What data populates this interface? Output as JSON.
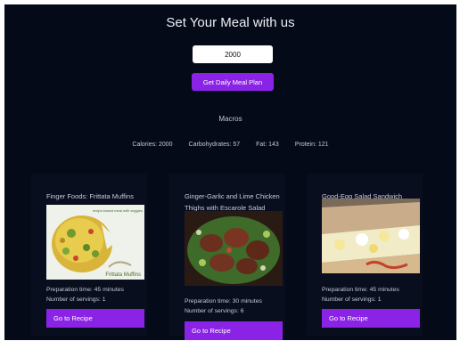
{
  "page": {
    "title": "Set Your Meal with us"
  },
  "form": {
    "calories_value": "2000",
    "button_label": "Get Daily Meal Plan"
  },
  "macros": {
    "heading": "Macros",
    "calories": "Calories: 2000",
    "carbs": "Carbohydrates: 57",
    "fat": "Fat: 143",
    "protein": "Protein: 121"
  },
  "meals": [
    {
      "title": "Finger Foods: Frittata Muffins",
      "prep": "Preparation time: 45 minutes",
      "servings": "Number of servings: 1",
      "button": "Go to Recipe",
      "img_caption": "Frittata Muffins",
      "img_corner": "recipe-based meal with veggies"
    },
    {
      "title": "Ginger-Garlic and Lime Chicken Thighs with Escarole Salad",
      "prep": "Preparation time: 30 minutes",
      "servings": "Number of servings: 6",
      "button": "Go to Recipe"
    },
    {
      "title": "Good-Egg Salad Sandwich",
      "prep": "Preparation time: 45 minutes",
      "servings": "Number of servings: 1",
      "button": "Go to Recipe"
    }
  ],
  "colors": {
    "background": "#050a18",
    "card": "#090e1e",
    "accent": "#8a23e6"
  }
}
